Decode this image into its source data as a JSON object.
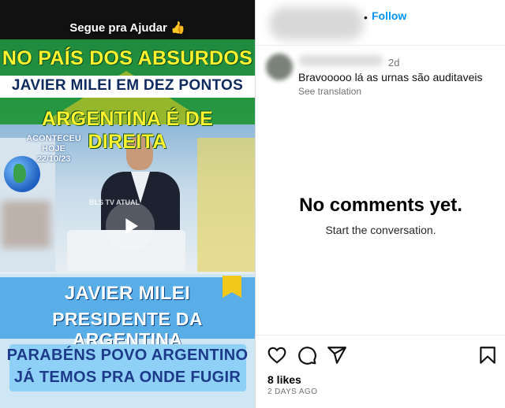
{
  "video": {
    "caption_top": "Segue pra Ajudar 👍",
    "headline_1": "NO PAÍS DOS ABSURDOS",
    "headline_2": "JAVIER MILEI EM DEZ PONTOS",
    "headline_3": "ARGENTINA É DE DIREITA",
    "date_label": "ACONTECEU HOJE",
    "date_value": "22/10/23",
    "channel_logo": "BLS TV ATUAL",
    "lower_name": "JAVIER MILEI",
    "lower_title": "PRESIDENTE DA ARGENTINA",
    "lower_msg_1": "PARABÉNS POVO ARGENTINO",
    "lower_msg_2": "JÁ TEMOS PRA ONDE FUGIR"
  },
  "header": {
    "dot": "•",
    "follow_label": "Follow"
  },
  "comment": {
    "time": "2d",
    "text": "Bravooooo lá as urnas são auditaveis",
    "translate_label": "See translation"
  },
  "empty_state": {
    "title": "No comments yet.",
    "subtitle": "Start the conversation."
  },
  "actions": {
    "likes": "8 likes",
    "posted": "2 DAYS AGO",
    "icons": [
      "heart-icon",
      "comment-icon",
      "share-icon",
      "bookmark-icon"
    ]
  },
  "colors": {
    "accent": "#0095f6",
    "banner_yellow": "#fff330",
    "banner_blue": "#5aaee7"
  }
}
